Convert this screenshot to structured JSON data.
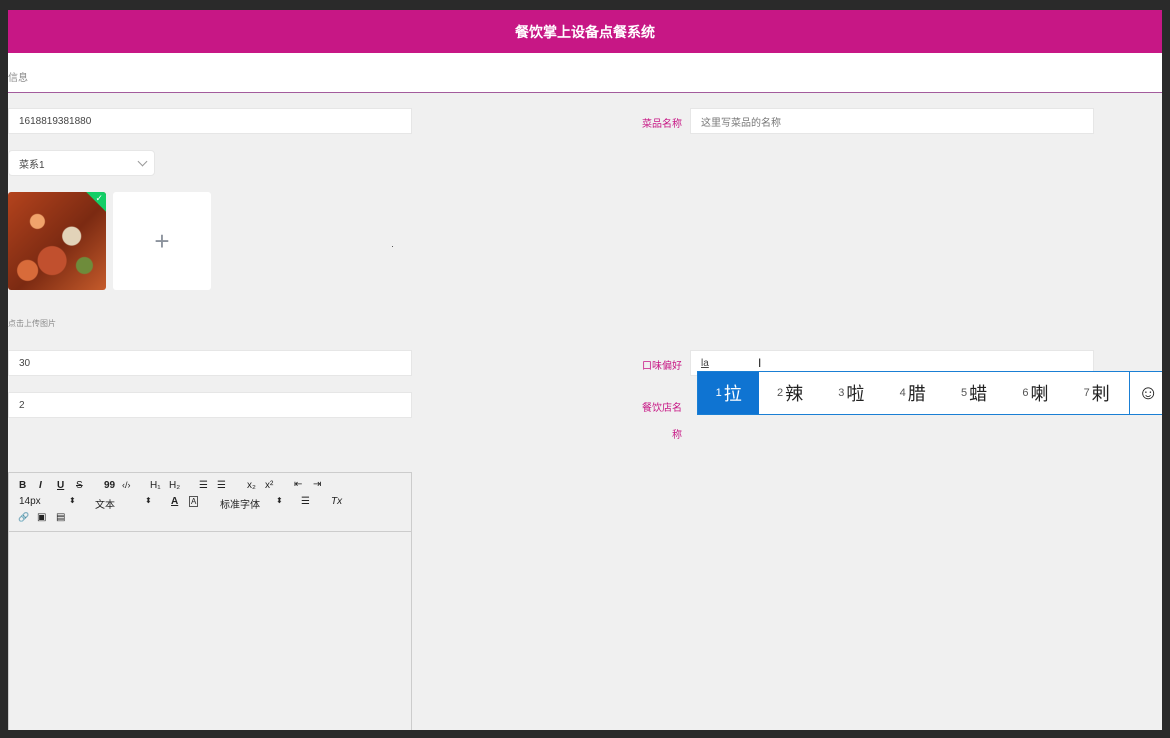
{
  "header": {
    "title": "餐饮掌上设备点餐系统"
  },
  "breadcrumb": {
    "text": "信息"
  },
  "form": {
    "id_field": {
      "value": "1618819381880"
    },
    "dish_name": {
      "label": "菜品名称",
      "placeholder": "这里写菜品的名称"
    },
    "category": {
      "value": "菜系1"
    },
    "upload_hint": "点击上传图片",
    "upload_plus": "+",
    "price": {
      "value": "30"
    },
    "quantity": {
      "value": "2"
    },
    "taste": {
      "label": "口味偏好",
      "value": "la"
    },
    "restaurant_name": {
      "label_line1": "餐饮店名",
      "label_line2": "称"
    }
  },
  "editor": {
    "toolbar": {
      "bold": "B",
      "italic": "I",
      "underline": "U",
      "strike": "S",
      "quote": "99",
      "code": "‹/›",
      "h1": "H₁",
      "h2": "H₂",
      "ordered_list": "☰",
      "bullet_list": "☰",
      "subscript": "x₂",
      "superscript": "x²",
      "outdent": "⇤",
      "indent": "⇥",
      "font_size": "14px",
      "font_size_arrow": "⬍",
      "text_style": "文本",
      "text_style_arrow": "⬍",
      "font_color": "A",
      "bg_color": "A",
      "font_family": "标准字体",
      "font_family_arrow": "⬍",
      "align": "☰",
      "clear_format": "Tx",
      "link": "🔗",
      "image": "▣",
      "video": "▤"
    }
  },
  "ime": {
    "composition": "I",
    "candidates": [
      {
        "num": "1",
        "char": "拉"
      },
      {
        "num": "2",
        "char": "辣"
      },
      {
        "num": "3",
        "char": "啦"
      },
      {
        "num": "4",
        "char": "腊"
      },
      {
        "num": "5",
        "char": "蜡"
      },
      {
        "num": "6",
        "char": "喇"
      },
      {
        "num": "7",
        "char": "剌"
      }
    ],
    "emoji": "☺"
  },
  "colors": {
    "brand": "#c71785",
    "ime_highlight": "#0f74d2",
    "check_badge": "#13ce66"
  }
}
